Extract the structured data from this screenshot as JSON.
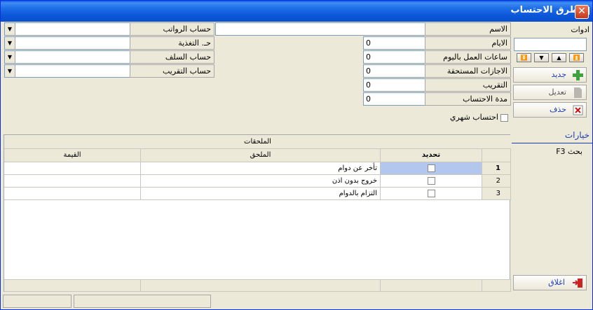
{
  "window": {
    "title": "طرق الاحتساب",
    "close_label": "✕",
    "title_color": "#0a56d9",
    "face_color": "#ece9d8"
  },
  "form": {
    "name_label": "الاسم",
    "name_value": "",
    "days_label": "الايام",
    "days_value": "0",
    "hours_label": "ساعات العمل باليوم",
    "hours_value": "0",
    "leaves_label": "الاجازات المستحقة",
    "leaves_value": "0",
    "rounding_label": "التقريب",
    "rounding_value": "0",
    "period_label": "مدة الاحتساب",
    "period_value": "0",
    "monthly_label": "احتساب شهري",
    "salary_account_label": "حساب الرواتب",
    "salary_account_value": "",
    "food_account_label": "حـ. التغذية",
    "food_account_value": "",
    "advance_account_label": "حساب السلف",
    "advance_account_value": "",
    "rounding_account_label": "حساب التقريب",
    "rounding_account_value": ""
  },
  "grid": {
    "group_header": "الملحقات",
    "col_select": "تحديد",
    "col_attachment": "الملحق",
    "col_value": "القيمة",
    "rows": [
      {
        "num": "1",
        "attachment": "تأخر عن دوام",
        "value": ""
      },
      {
        "num": "2",
        "attachment": "خروج بدون اذن",
        "value": ""
      },
      {
        "num": "3",
        "attachment": "التزام بالدوام",
        "value": ""
      }
    ]
  },
  "sidebar": {
    "tools_label": "ادوات",
    "new_label": "جديد",
    "edit_label": "تعديل",
    "delete_label": "حذف",
    "options_label": "خيارات",
    "search_label": "بحث F3",
    "close_label": "اغلاق"
  }
}
